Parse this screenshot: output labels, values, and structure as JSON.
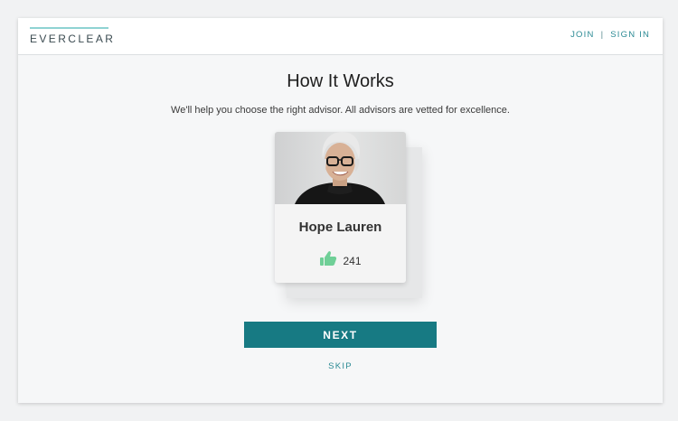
{
  "header": {
    "logo": "EVERCLEAR",
    "nav": {
      "join": "JOIN",
      "separator": "|",
      "sign_in": "SIGN IN"
    }
  },
  "main": {
    "title": "How It Works",
    "subtitle": "We'll help you choose the right advisor. All advisors are vetted for excellence.",
    "advisor_card": {
      "name": "Hope Lauren",
      "likes": "241",
      "like_icon": "thumbs-up-icon",
      "photo": "advisor-photo"
    },
    "next_label": "NEXT",
    "skip_label": "SKIP"
  },
  "colors": {
    "accent": "#177a83",
    "link": "#2b8a94",
    "logo_bar": "#8fd3d3",
    "thumb": "#6fcf97"
  }
}
